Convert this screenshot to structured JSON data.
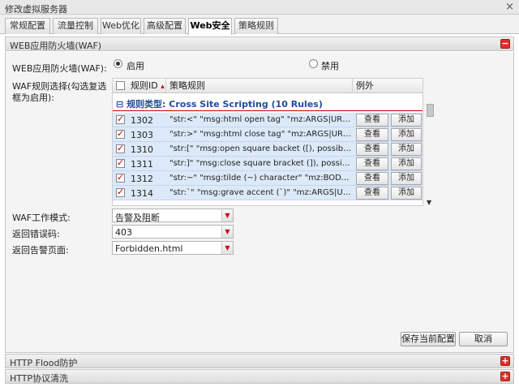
{
  "window": {
    "title": "修改虚拟服务器",
    "close_glyph": "×"
  },
  "tabs": [
    {
      "label": "常规配置",
      "active": false
    },
    {
      "label": "流量控制",
      "active": false
    },
    {
      "label": "Web优化",
      "active": false
    },
    {
      "label": "高级配置",
      "active": false
    },
    {
      "label": "Web安全",
      "active": true
    },
    {
      "label": "策略规则",
      "active": false
    }
  ],
  "waf_panel": {
    "title": "WEB应用防火墙(WAF)",
    "collapse_glyph": "−",
    "waf_label": "WEB应用防火墙(WAF):",
    "radio_enable": {
      "label": "启用",
      "checked": true
    },
    "radio_disable": {
      "label": "禁用",
      "checked": false
    },
    "rule_select_label": "WAF规则选择(勾选复选框为启用):",
    "grid": {
      "col_id": "规则ID",
      "sort_glyph": "▴",
      "col_policy": "策略规则",
      "col_exception": "例外",
      "group_glyph": "⊟",
      "group_title": "规则类型: Cross Site Scripting (10 Rules)",
      "view_label": "查看",
      "add_label": "添加",
      "rows": [
        {
          "id": "1302",
          "policy": "\"str:<\" \"msg:html open tag\" \"mz:ARGS|URL|BODY|...",
          "checked": true
        },
        {
          "id": "1303",
          "policy": "\"str:>\" \"msg:html close tag\" \"mz:ARGS|URL|BODY...",
          "checked": true
        },
        {
          "id": "1310",
          "policy": "\"str:[\" \"msg:open square backet ([), possible js\" \"m...",
          "checked": true
        },
        {
          "id": "1311",
          "policy": "\"str:]\" \"msg:close square bracket (]), possible js\" \"m...",
          "checked": true
        },
        {
          "id": "1312",
          "policy": "\"str:~\" \"msg:tilde (~) character\" \"mz:BODY|URL|AR...",
          "checked": true
        },
        {
          "id": "1314",
          "policy": "\"str:`\" \"msg:grave accent (`)\" \"mz:ARGS|URL|BOD...",
          "checked": true
        }
      ]
    },
    "mode_label": "WAF工作模式:",
    "mode_value": "告警及阻断",
    "error_code_label": "返回错误码:",
    "error_code_value": "403",
    "alert_page_label": "返回告警页面:",
    "alert_page_value": "Forbidden.html",
    "save_label": "保存当前配置",
    "cancel_label": "取消"
  },
  "http_flood_panel": {
    "title": "HTTP Flood防护",
    "expand_glyph": "+"
  },
  "http_protocol_panel": {
    "title": "HTTP协议清洗",
    "expand_glyph": "+"
  },
  "colors": {
    "accent_red": "#d9322a",
    "group_blue": "#1f4e96",
    "row_bg": "#dce9f8"
  }
}
